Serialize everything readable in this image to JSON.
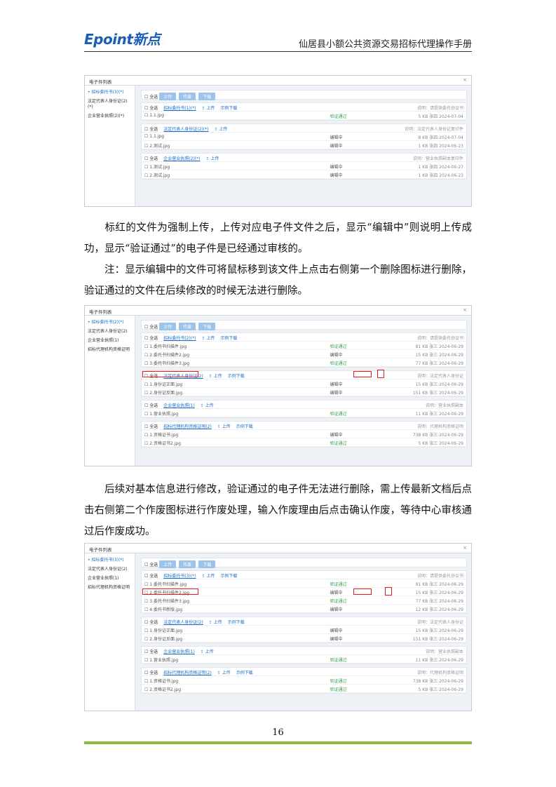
{
  "header": {
    "logo": "Epoint新点",
    "title": "仙居县小额公共资源交易招标代理操作手册"
  },
  "paragraphs": {
    "p1": "标红的文件为强制上传，上传对应电子件文件之后，显示“编辑中”则说明上传成功，显示“验证通过”的电子件是已经通过审核的。",
    "p2": "注：显示编辑中的文件可将鼠标移到该文件上点击右侧第一个删除图标进行删除，验证通过的文件在后续修改的时候无法进行删除。",
    "p3": "后续对基本信息进行修改，验证通过的电子件无法进行删除，需上传最新文档后点击右侧第二个作废图标进行作废处理，输入作废理由后点击确认作废，等待中心审核通过后作废成功。"
  },
  "shot1": {
    "title": "电子件列表",
    "close": "×",
    "side": [
      "• 招标委托书(3)(*)",
      "法定代表人身份证(2)(*)",
      "企业营业执照(2)(*)"
    ],
    "toolbar": [
      "全选",
      "上传",
      "作废",
      "下载"
    ],
    "groups": [
      {
        "name": "招标委托书(1)(*)",
        "upload": "上传",
        "download": "示例下载",
        "hint": "说明：请提供委托协议书",
        "rows": [
          {
            "name": "1.1.jpg",
            "status": "验证通过",
            "ok": true,
            "meta": "5 KB  张四  2024-07-04"
          }
        ]
      },
      {
        "name": "法定代表人身份证(2)(*)",
        "upload": "上传",
        "download": "",
        "hint": "说明：法定代表人身份证复印件",
        "rows": [
          {
            "name": "1.1.jpg",
            "status": "编辑中",
            "ok": false,
            "meta": "8 KB  张四  2024-07-04"
          },
          {
            "name": "2.测试.jpg",
            "status": "编辑中",
            "ok": false,
            "meta": "1 KB  张四  2024-06-23"
          }
        ]
      },
      {
        "name": "企业营业执照(2)(*)",
        "upload": "上传",
        "download": "",
        "hint": "说明：营业执照副本复印件",
        "rows": [
          {
            "name": "1.测试.jpg",
            "status": "编辑中",
            "ok": false,
            "meta": "1 KB  张四  2024-06-27"
          },
          {
            "name": "2.测试.jpg",
            "status": "编辑中",
            "ok": false,
            "meta": "1 KB  张四  2024-06-23"
          }
        ]
      }
    ]
  },
  "shot2": {
    "title": "电子件列表",
    "close": "×",
    "side": [
      "• 招标委托书(2)(*)",
      "法定代表人身份证(2)",
      "企业营业执照(1)",
      "招标代理机构资格证明"
    ],
    "toolbar": [
      "全选",
      "上传",
      "作废",
      "下载"
    ],
    "groups": [
      {
        "name": "招标委托书(2)(*)",
        "upload": "上传",
        "download": "示例下载",
        "hint": "说明：请提供委托协议书",
        "rows": [
          {
            "name": "1.委托书扫描件.jpg",
            "status": "验证通过",
            "ok": true,
            "meta": "81 KB  张三  2024-06-29"
          },
          {
            "name": "2.委托书扫描件2.jpg",
            "status": "编辑中",
            "ok": false,
            "meta": "15 KB  张三  2024-06-29"
          },
          {
            "name": "3.委托书扫描件3.jpg",
            "status": "验证通过",
            "ok": true,
            "meta": "77 KB  张三  2024-06-29"
          }
        ]
      },
      {
        "name": "法定代表人身份证(2)",
        "upload": "上传",
        "download": "示例下载",
        "hint": "说明：法定代表人身份证",
        "rows": [
          {
            "name": "1.身份证正面.jpg",
            "status": "编辑中",
            "ok": false,
            "meta": "15 KB  张三  2024-06-29"
          },
          {
            "name": "2.身份证反面.jpg",
            "status": "编辑中",
            "ok": false,
            "meta": "151 KB  张三  2024-06-29"
          }
        ]
      },
      {
        "name": "企业营业执照(1)",
        "upload": "上传",
        "download": "",
        "hint": "说明：营业执照副本",
        "rows": [
          {
            "name": "1.营业执照.jpg",
            "status": "验证通过",
            "ok": true,
            "meta": "11 KB  张三  2024-06-29"
          }
        ]
      },
      {
        "name": "招标代理机构资格证明(2)",
        "upload": "上传",
        "download": "示例下载",
        "hint": "说明：代理机构资格证明",
        "rows": [
          {
            "name": "1.资格证书.jpg",
            "status": "编辑中",
            "ok": false,
            "meta": "738 KB  张三  2024-06-29"
          },
          {
            "name": "2.资格证书2.jpg",
            "status": "验证通过",
            "ok": true,
            "meta": "5 KB  张三  2024-06-29"
          }
        ]
      }
    ]
  },
  "shot3": {
    "title": "电子件列表",
    "close": "×",
    "side": [
      "• 招标委托书(3)(*)",
      "法定代表人身份证(2)",
      "企业营业执照(1)",
      "招标代理机构资格证明"
    ],
    "toolbar": [
      "全选",
      "上传",
      "作废",
      "下载"
    ],
    "groups": [
      {
        "name": "招标委托书(3)(*)",
        "upload": "上传",
        "download": "示例下载",
        "hint": "说明：请提供委托协议书",
        "rows": [
          {
            "name": "1.委托书扫描件.jpg",
            "status": "验证通过",
            "ok": true,
            "meta": "81 KB  张三  2024-06-29"
          },
          {
            "name": "2.委托书扫描件2.jpg",
            "status": "编辑中",
            "ok": false,
            "meta": "15 KB  张三  2024-06-29"
          },
          {
            "name": "3.委托书扫描件3.jpg",
            "status": "验证通过",
            "ok": true,
            "meta": "77 KB  张三  2024-06-29"
          },
          {
            "name": "4.委托书新版.jpg",
            "status": "编辑中",
            "ok": false,
            "meta": "12 KB  张三  2024-06-29"
          }
        ]
      },
      {
        "name": "法定代表人身份证(2)",
        "upload": "上传",
        "download": "示例下载",
        "hint": "说明：法定代表人身份证",
        "rows": [
          {
            "name": "1.身份证正面.jpg",
            "status": "编辑中",
            "ok": false,
            "meta": "15 KB  张三  2024-06-29"
          },
          {
            "name": "2.身份证反面.jpg",
            "status": "编辑中",
            "ok": false,
            "meta": "151 KB  张三  2024-06-29"
          }
        ]
      },
      {
        "name": "企业营业执照(1)",
        "upload": "上传",
        "download": "",
        "hint": "说明：营业执照副本",
        "rows": [
          {
            "name": "1.营业执照.jpg",
            "status": "验证通过",
            "ok": true,
            "meta": "11 KB  张三  2024-06-29"
          }
        ]
      },
      {
        "name": "招标代理机构资格证明(2)",
        "upload": "上传",
        "download": "示例下载",
        "hint": "说明：代理机构资格证明",
        "rows": [
          {
            "name": "1.资格证书.jpg",
            "status": "验证通过",
            "ok": true,
            "meta": "738 KB  张三  2024-06-29"
          },
          {
            "name": "2.资格证书2.jpg",
            "status": "验证通过",
            "ok": true,
            "meta": "5 KB  张三  2024-06-29"
          }
        ]
      }
    ]
  },
  "footer": {
    "page_number": "16"
  }
}
